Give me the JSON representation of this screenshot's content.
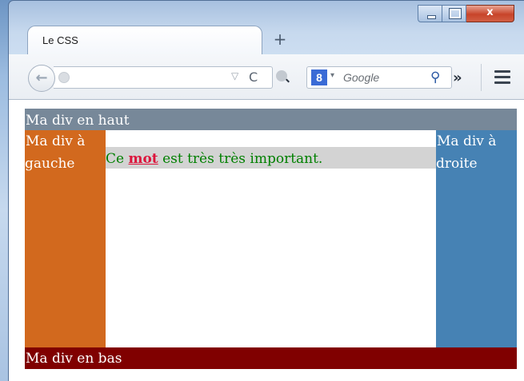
{
  "browser": {
    "tab_title": "Le CSS",
    "new_tab_symbol": "+",
    "back_symbol": "←",
    "url_dropdown_symbol": "▽",
    "reload_symbol": "C",
    "search_engine_letter": "8",
    "search_dropdown_symbol": "▾",
    "search_placeholder": "Google",
    "search_button_symbol": "⚲",
    "overflow_symbol": "»",
    "icons": [
      "back-arrow-icon",
      "globe-icon",
      "reload-icon",
      "search-engine-icon",
      "magnifier-icon",
      "overflow-chevron-icon",
      "hamburger-menu-icon"
    ]
  },
  "window_controls": {
    "close_symbol": "x"
  },
  "page": {
    "haut": "Ma div en haut",
    "gauche": "Ma div à gauche",
    "droite": "Ma div à droite",
    "bas": "Ma div en bas",
    "phrase_before": "Ce ",
    "phrase_emphasis": "mot",
    "phrase_after": " est très très important."
  },
  "colors": {
    "haut": "#778899",
    "gauche": "#d2691e",
    "droite": "#4682b4",
    "bas": "#800000",
    "phrase_bg": "#d3d3d3",
    "phrase_text": "#008000",
    "emphasis": "#dc143c"
  }
}
